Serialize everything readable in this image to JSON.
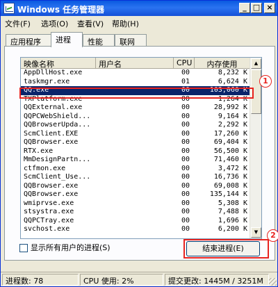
{
  "window": {
    "title": "Windows 任务管理器",
    "minimize": "_",
    "maximize": "□",
    "close": "×"
  },
  "menu": [
    {
      "label": "文件(F)"
    },
    {
      "label": "选项(O)"
    },
    {
      "label": "查看(V)"
    },
    {
      "label": "帮助(H)"
    }
  ],
  "tabs": [
    {
      "label": "应用程序"
    },
    {
      "label": "进程",
      "active": true
    },
    {
      "label": "性能"
    },
    {
      "label": "联网"
    }
  ],
  "columns": {
    "name": "映像名称",
    "user": "用户名",
    "cpu": "CPU",
    "mem": "内存使用"
  },
  "processes": [
    {
      "name": "AppDllHost.exe",
      "cpu": "00",
      "mem": "8,232 K"
    },
    {
      "name": "taskmgr.exe",
      "cpu": "01",
      "mem": "6,624 K"
    },
    {
      "name": "QQ.exe",
      "cpu": "00",
      "mem": "103,060 K",
      "selected": true
    },
    {
      "name": "TXPlatform.exe",
      "cpu": "00",
      "mem": "1,264 K"
    },
    {
      "name": "QQExternal.exe",
      "cpu": "00",
      "mem": "28,992 K"
    },
    {
      "name": "QQPCWebShield...",
      "cpu": "00",
      "mem": "9,164 K"
    },
    {
      "name": "QQBrowserUpda...",
      "cpu": "00",
      "mem": "2,292 K"
    },
    {
      "name": "ScmClient.EXE",
      "cpu": "00",
      "mem": "17,260 K"
    },
    {
      "name": "QQBrowser.exe",
      "cpu": "00",
      "mem": "69,404 K"
    },
    {
      "name": "RTX.exe",
      "cpu": "00",
      "mem": "56,500 K"
    },
    {
      "name": "MmDesignPartn...",
      "cpu": "00",
      "mem": "71,460 K"
    },
    {
      "name": "ctfmon.exe",
      "cpu": "00",
      "mem": "3,472 K"
    },
    {
      "name": "ScmClient_Use...",
      "cpu": "00",
      "mem": "16,736 K"
    },
    {
      "name": "QQBrowser.exe",
      "cpu": "00",
      "mem": "69,008 K"
    },
    {
      "name": "QQBrowser.exe",
      "cpu": "00",
      "mem": "135,144 K"
    },
    {
      "name": "wmiprvse.exe",
      "cpu": "00",
      "mem": "5,308 K"
    },
    {
      "name": "stsystra.exe",
      "cpu": "00",
      "mem": "7,488 K"
    },
    {
      "name": "QQPCTray.exe",
      "cpu": "00",
      "mem": "1,696 K"
    },
    {
      "name": "svchost.exe",
      "cpu": "00",
      "mem": "6,200 K"
    }
  ],
  "scrollbar": {
    "up": "▲",
    "down": "▼"
  },
  "show_all_users": {
    "label": "显示所有用户的进程(S)",
    "checked": false
  },
  "end_process": {
    "label": "结束进程(E)"
  },
  "markers": {
    "one": "1",
    "two": "2"
  },
  "status": {
    "processes": "进程数: 78",
    "cpu": "CPU 使用: 2%",
    "commit": "提交更改: 1445M / 3251M"
  },
  "colors": {
    "selection": "#0a246a",
    "annotation": "#e8231f",
    "titlebar": "#0a5ae0"
  }
}
